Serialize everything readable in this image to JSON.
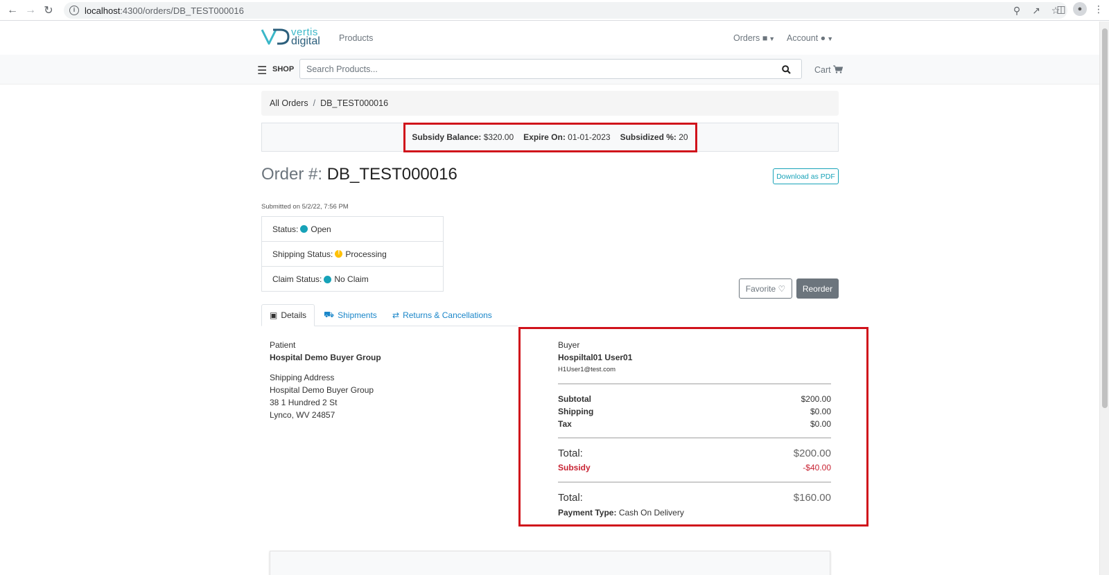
{
  "browser": {
    "url_host": "localhost",
    "url_rest": ":4300/orders/DB_TEST000016"
  },
  "nav": {
    "logo_line1": "vertis",
    "logo_line2": "digital",
    "products": "Products",
    "orders": "Orders",
    "account": "Account"
  },
  "shopbar": {
    "shop_label": "SHOP",
    "search_placeholder": "Search Products...",
    "cart": "Cart"
  },
  "breadcrumb": {
    "all_orders": "All Orders",
    "separator": "/",
    "current": "DB_TEST000016"
  },
  "subsidy": {
    "balance_label": "Subsidy Balance:",
    "balance_value": "$320.00",
    "expire_label": "Expire On:",
    "expire_value": "01-01-2023",
    "percent_label": "Subsidized %:",
    "percent_value": "20"
  },
  "order": {
    "title_label": "Order #:",
    "number": "DB_TEST000016",
    "download_label": "Download as PDF",
    "submitted": "Submitted on 5/2/22, 7:56 PM",
    "status_label": "Status:",
    "status_value": "Open",
    "shipping_status_label": "Shipping Status:",
    "shipping_status_value": "Processing",
    "claim_status_label": "Claim Status:",
    "claim_status_value": "No Claim",
    "favorite_label": "Favorite",
    "reorder_label": "Reorder"
  },
  "tabs": {
    "details": "Details",
    "shipments": "Shipments",
    "returns": "Returns & Cancellations"
  },
  "patient": {
    "label": "Patient",
    "name": "Hospital Demo Buyer Group",
    "address_label": "Shipping Address",
    "address_line1": "Hospital Demo Buyer Group",
    "address_line2": "38 1 Hundred 2 St",
    "address_line3": "Lynco, WV 24857"
  },
  "buyer": {
    "label": "Buyer",
    "name": "Hospiltal01 User01",
    "email": "H1User1@test.com",
    "subtotal_label": "Subtotal",
    "subtotal_value": "$200.00",
    "shipping_label": "Shipping",
    "shipping_value": "$0.00",
    "tax_label": "Tax",
    "tax_value": "$0.00",
    "total1_label": "Total:",
    "total1_value": "$200.00",
    "subsidy_label": "Subsidy",
    "subsidy_value": "-$40.00",
    "total2_label": "Total:",
    "total2_value": "$160.00",
    "payment_label": "Payment Type:",
    "payment_value": "Cash On Delivery"
  },
  "colors": {
    "accent_teal": "#17a2b8",
    "link_blue": "#1a86c9",
    "highlight_red": "#d0121b",
    "subsidy_red": "#c82333",
    "warning_yellow": "#ffc107"
  }
}
